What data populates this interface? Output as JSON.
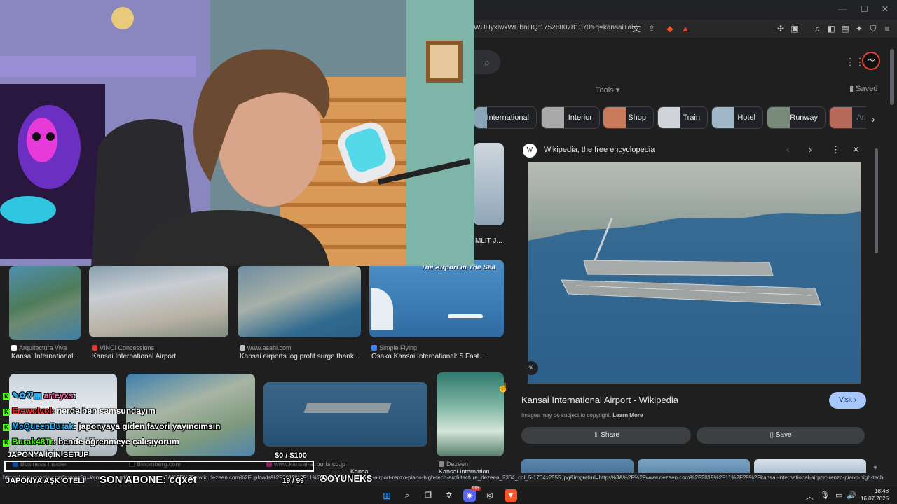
{
  "browser": {
    "url": "WUHyxlwxWLibnHQ:1752680781370&q=kansai+ai...",
    "status_url": "https://www.google.com/imgres?q=kansai+airport&imgurl=https%3A%2F%2Fstatic.dezeen.com%2Fuploads%2F2019%2F11%2Fkansai-international-airport-renzo-piano-high-tech-architecture_dezeen_2364_col_5-1704x2555.jpg&imgrefurl=https%3A%2F%2Fwww.dezeen.com%2F2019%2F11%2F29%2Fkansai-international-airport-renzo-piano-high-tech-..."
  },
  "header": {
    "tools": "Tools",
    "saved": "Saved"
  },
  "chips": [
    {
      "label": "International",
      "color": "#8aa4b8"
    },
    {
      "label": "Interior",
      "color": "#a9a9a9"
    },
    {
      "label": "Shop",
      "color": "#c97a5a"
    },
    {
      "label": "Train",
      "color": "#d0d4d8"
    },
    {
      "label": "Hotel",
      "color": "#9fb7c7"
    },
    {
      "label": "Runway",
      "color": "#7a8a7a"
    },
    {
      "label": "Ar...",
      "color": "#b86a5a"
    }
  ],
  "results": [
    {
      "source": "Arquitectura Viva",
      "title": "Kansai International..."
    },
    {
      "source": "VINCI Concessions",
      "title": "Kansai International Airport"
    },
    {
      "source": "www.asahi.com",
      "title": "Kansai airports log profit surge thank..."
    },
    {
      "source": "Simple Flying",
      "title": "Osaka Kansai International: 5 Fast ...",
      "badge": "The Airport In The Sea"
    },
    {
      "source": "Business Insider",
      "title": ""
    },
    {
      "source": "Bloomberg.com",
      "title": ""
    },
    {
      "source": "www.kansai-airports.co.jp",
      "title": "Kansai..."
    },
    {
      "source": "Dezeen",
      "title": "Kansai Internation..."
    }
  ],
  "partial_result": {
    "title": "MLIT J..."
  },
  "panel": {
    "source": "Wikipedia, the free encyclopedia",
    "title": "Kansai International Airport - Wikipedia",
    "visit": "Visit",
    "copyright": "Images may be subject to copyright.",
    "learn_more": "Learn More",
    "share": "Share",
    "save": "Save"
  },
  "chat": [
    {
      "user": "arteyxs",
      "message": ":",
      "color": "#ff5aa0"
    },
    {
      "user": "Erewolvol",
      "message": ": nerde ben samsundayım",
      "color": "#ff3030"
    },
    {
      "user": "McQueenBurak",
      "message": ": japonyaya giden favori yayıncımsın",
      "color": "#2fb7ff"
    },
    {
      "user": "Burak48Tr",
      "message": ": bende öğrenmeye çalışıyorum",
      "color": "#53fc18"
    }
  ],
  "stream_overlay": {
    "goal_label": "JAPONYA İÇİN SETUP",
    "goal_amount": "$0  / $100",
    "hotel_label": "JAPONYA AŞK OTELİ",
    "last_sub": "SON ABONE: cqxet",
    "counter": "19  / 99",
    "brand": "OYUNEKS",
    "goal_progress": 0.0,
    "hotel_progress": 0.19
  },
  "taskbar": {
    "time": "18:48",
    "date": "16.07.2025",
    "badge_discord": "99+"
  }
}
